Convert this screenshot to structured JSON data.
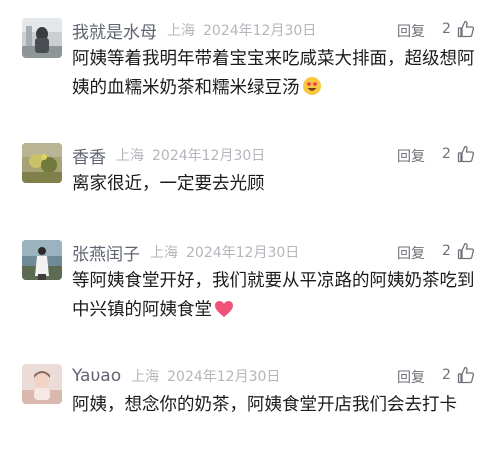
{
  "comments": [
    {
      "username": "我就是水母",
      "location": "上海",
      "date": "2024年12月30日",
      "reply_label": "回复",
      "likes": "2",
      "text": "阿姨等着我明年带着宝宝来吃咸菜大排面，超级想阿姨的血糯米奶茶和糯米绿豆汤",
      "emoji": "heart-eyes-face-icon"
    },
    {
      "username": "香香",
      "location": "上海",
      "date": "2024年12月30日",
      "reply_label": "回复",
      "likes": "2",
      "text": "离家很近，一定要去光顾"
    },
    {
      "username": "张燕闰子",
      "location": "上海",
      "date": "2024年12月30日",
      "reply_label": "回复",
      "likes": "2",
      "text": "等阿姨食堂开好，我们就要从平凉路的阿姨奶茶吃到中兴镇的阿姨食堂",
      "emoji": "pink-heart-icon"
    },
    {
      "username": "Yaυao",
      "location": "上海",
      "date": "2024年12月30日",
      "reply_label": "回复",
      "likes": "2",
      "text": "阿姨，想念你的奶茶，阿姨食堂开店我们会去打卡"
    }
  ],
  "colors": {
    "username": "#5f6470",
    "meta": "#b3b6bb",
    "text": "#1b1b1b"
  }
}
